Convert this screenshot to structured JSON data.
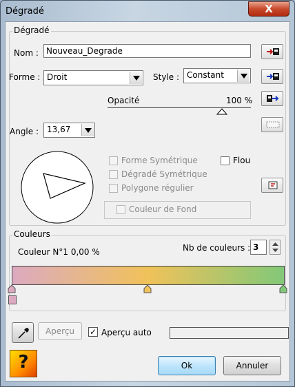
{
  "window": {
    "title": "Dégradé",
    "close_label": "X"
  },
  "degrade": {
    "group_label": "Dégradé",
    "nom_label": "Nom :",
    "nom_value": "Nouveau_Degrade",
    "forme_label": "Forme :",
    "forme_value": "Droit",
    "style_label": "Style :",
    "style_value": "Constant",
    "opacite_label": "Opacité",
    "opacite_value": "100 %",
    "opacite_level": 1.0,
    "angle_label": "Angle :",
    "angle_value": "13,67",
    "forme_symetrique": "Forme Symétrique",
    "degrade_symetrique": "Dégradé Symétrique",
    "polygone_regulier": "Polygone régulier",
    "flou": "Flou",
    "couleur_de_fond": "Couleur de Fond"
  },
  "couleurs": {
    "group_label": "Couleurs",
    "info": "Couleur N°1 0,00 %",
    "nb_label": "Nb de couleurs :",
    "nb_value": "3",
    "gradient_colors": [
      "#dcaac0",
      "#f0c25a",
      "#82c878"
    ],
    "stop_positions": [
      0,
      0.5,
      1
    ],
    "selected_swatch_color": "#dcaac0"
  },
  "footer": {
    "apercu_label": "Aperçu",
    "apercu_auto_label": "Aperçu auto",
    "apercu_auto_checked": "✓",
    "ok_label": "Ok",
    "annuler_label": "Annuler",
    "help_glyph": "?"
  },
  "icons": [
    "close-icon",
    "load-icon",
    "save-icon",
    "export-icon",
    "blank-icon",
    "paste-icon",
    "eyedropper-icon",
    "help-icon",
    "triangle-shape-icon"
  ]
}
